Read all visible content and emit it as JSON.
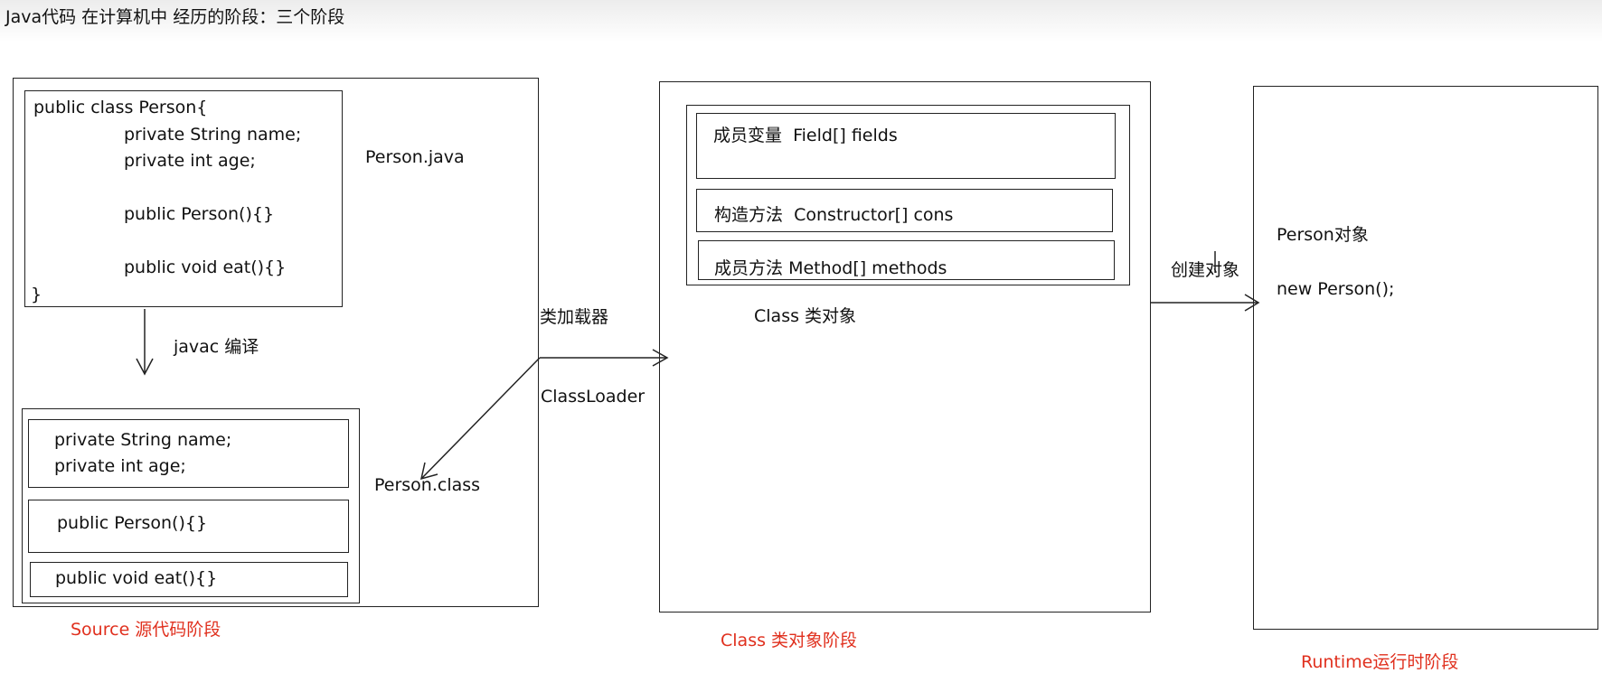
{
  "title": "Java代码 在计算机中 经历的阶段：三个阶段",
  "source_stage": {
    "java_file_lines": [
      "public class Person{",
      "private String name;",
      "private int age;",
      "public Person(){}",
      "public void eat(){}",
      "}"
    ],
    "java_file_label": "Person.java",
    "compile_label": "javac 编译",
    "class_file_sections": [
      [
        "private String name;",
        "private int age;"
      ],
      [
        "public Person(){}"
      ],
      [
        "public void eat(){}"
      ]
    ],
    "class_file_label": "Person.class",
    "stage_label": "Source 源代码阶段"
  },
  "loader": {
    "label_cn": "类加载器",
    "label_en": "ClassLoader"
  },
  "class_stage": {
    "members": [
      {
        "cn": "成员变量",
        "en": "Field[] fields"
      },
      {
        "cn": "构造方法",
        "en": "Constructor[] cons"
      },
      {
        "cn": "成员方法",
        "en": "Method[] methods"
      }
    ],
    "object_label": "Class 类对象",
    "stage_label": "Class 类对象阶段"
  },
  "create_label": "创建对象",
  "runtime_stage": {
    "object_label": "Person对象",
    "code": "new Person();",
    "stage_label": "Runtime运行时阶段"
  },
  "colors": {
    "stage_label": "#e0301e",
    "line": "#222222"
  }
}
